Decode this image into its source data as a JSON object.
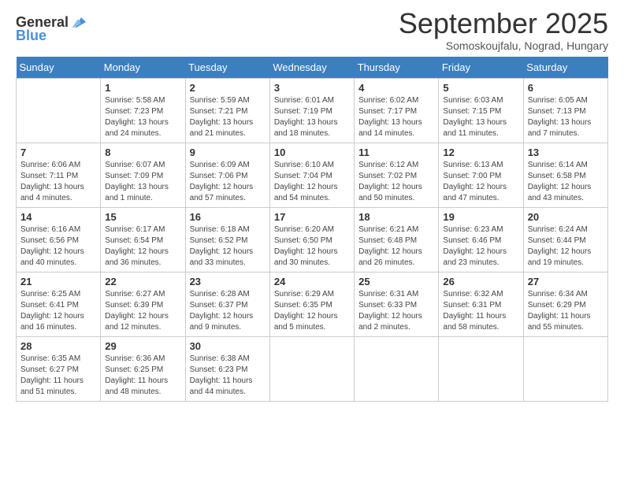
{
  "logo": {
    "general": "General",
    "blue": "Blue"
  },
  "title": "September 2025",
  "subtitle": "Somoskoujfalu, Nograd, Hungary",
  "days_of_week": [
    "Sunday",
    "Monday",
    "Tuesday",
    "Wednesday",
    "Thursday",
    "Friday",
    "Saturday"
  ],
  "weeks": [
    [
      {
        "day": "",
        "info": ""
      },
      {
        "day": "1",
        "info": "Sunrise: 5:58 AM\nSunset: 7:23 PM\nDaylight: 13 hours and 24 minutes."
      },
      {
        "day": "2",
        "info": "Sunrise: 5:59 AM\nSunset: 7:21 PM\nDaylight: 13 hours and 21 minutes."
      },
      {
        "day": "3",
        "info": "Sunrise: 6:01 AM\nSunset: 7:19 PM\nDaylight: 13 hours and 18 minutes."
      },
      {
        "day": "4",
        "info": "Sunrise: 6:02 AM\nSunset: 7:17 PM\nDaylight: 13 hours and 14 minutes."
      },
      {
        "day": "5",
        "info": "Sunrise: 6:03 AM\nSunset: 7:15 PM\nDaylight: 13 hours and 11 minutes."
      },
      {
        "day": "6",
        "info": "Sunrise: 6:05 AM\nSunset: 7:13 PM\nDaylight: 13 hours and 7 minutes."
      }
    ],
    [
      {
        "day": "7",
        "info": "Sunrise: 6:06 AM\nSunset: 7:11 PM\nDaylight: 13 hours and 4 minutes."
      },
      {
        "day": "8",
        "info": "Sunrise: 6:07 AM\nSunset: 7:09 PM\nDaylight: 13 hours and 1 minute."
      },
      {
        "day": "9",
        "info": "Sunrise: 6:09 AM\nSunset: 7:06 PM\nDaylight: 12 hours and 57 minutes."
      },
      {
        "day": "10",
        "info": "Sunrise: 6:10 AM\nSunset: 7:04 PM\nDaylight: 12 hours and 54 minutes."
      },
      {
        "day": "11",
        "info": "Sunrise: 6:12 AM\nSunset: 7:02 PM\nDaylight: 12 hours and 50 minutes."
      },
      {
        "day": "12",
        "info": "Sunrise: 6:13 AM\nSunset: 7:00 PM\nDaylight: 12 hours and 47 minutes."
      },
      {
        "day": "13",
        "info": "Sunrise: 6:14 AM\nSunset: 6:58 PM\nDaylight: 12 hours and 43 minutes."
      }
    ],
    [
      {
        "day": "14",
        "info": "Sunrise: 6:16 AM\nSunset: 6:56 PM\nDaylight: 12 hours and 40 minutes."
      },
      {
        "day": "15",
        "info": "Sunrise: 6:17 AM\nSunset: 6:54 PM\nDaylight: 12 hours and 36 minutes."
      },
      {
        "day": "16",
        "info": "Sunrise: 6:18 AM\nSunset: 6:52 PM\nDaylight: 12 hours and 33 minutes."
      },
      {
        "day": "17",
        "info": "Sunrise: 6:20 AM\nSunset: 6:50 PM\nDaylight: 12 hours and 30 minutes."
      },
      {
        "day": "18",
        "info": "Sunrise: 6:21 AM\nSunset: 6:48 PM\nDaylight: 12 hours and 26 minutes."
      },
      {
        "day": "19",
        "info": "Sunrise: 6:23 AM\nSunset: 6:46 PM\nDaylight: 12 hours and 23 minutes."
      },
      {
        "day": "20",
        "info": "Sunrise: 6:24 AM\nSunset: 6:44 PM\nDaylight: 12 hours and 19 minutes."
      }
    ],
    [
      {
        "day": "21",
        "info": "Sunrise: 6:25 AM\nSunset: 6:41 PM\nDaylight: 12 hours and 16 minutes."
      },
      {
        "day": "22",
        "info": "Sunrise: 6:27 AM\nSunset: 6:39 PM\nDaylight: 12 hours and 12 minutes."
      },
      {
        "day": "23",
        "info": "Sunrise: 6:28 AM\nSunset: 6:37 PM\nDaylight: 12 hours and 9 minutes."
      },
      {
        "day": "24",
        "info": "Sunrise: 6:29 AM\nSunset: 6:35 PM\nDaylight: 12 hours and 5 minutes."
      },
      {
        "day": "25",
        "info": "Sunrise: 6:31 AM\nSunset: 6:33 PM\nDaylight: 12 hours and 2 minutes."
      },
      {
        "day": "26",
        "info": "Sunrise: 6:32 AM\nSunset: 6:31 PM\nDaylight: 11 hours and 58 minutes."
      },
      {
        "day": "27",
        "info": "Sunrise: 6:34 AM\nSunset: 6:29 PM\nDaylight: 11 hours and 55 minutes."
      }
    ],
    [
      {
        "day": "28",
        "info": "Sunrise: 6:35 AM\nSunset: 6:27 PM\nDaylight: 11 hours and 51 minutes."
      },
      {
        "day": "29",
        "info": "Sunrise: 6:36 AM\nSunset: 6:25 PM\nDaylight: 11 hours and 48 minutes."
      },
      {
        "day": "30",
        "info": "Sunrise: 6:38 AM\nSunset: 6:23 PM\nDaylight: 11 hours and 44 minutes."
      },
      {
        "day": "",
        "info": ""
      },
      {
        "day": "",
        "info": ""
      },
      {
        "day": "",
        "info": ""
      },
      {
        "day": "",
        "info": ""
      }
    ]
  ]
}
